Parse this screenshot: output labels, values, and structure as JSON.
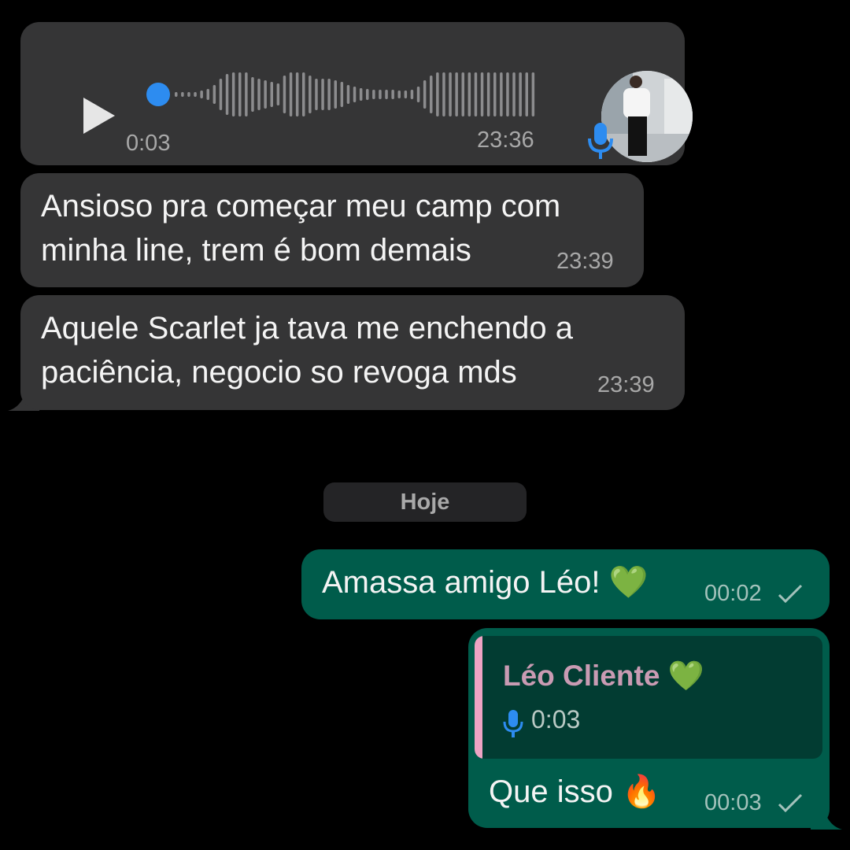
{
  "voice_message": {
    "duration": "0:03",
    "time": "23:36",
    "bar_heights": [
      3,
      3,
      3,
      3,
      5,
      7,
      12,
      20,
      26,
      28,
      28,
      28,
      22,
      20,
      18,
      16,
      14,
      24,
      28,
      28,
      28,
      24,
      20,
      20,
      20,
      18,
      16,
      12,
      10,
      8,
      7,
      6,
      6,
      6,
      6,
      5,
      5,
      6,
      10,
      18,
      24,
      28,
      28,
      28,
      28,
      28,
      28,
      28,
      28,
      28,
      28,
      28,
      28,
      28,
      28,
      28,
      28
    ]
  },
  "messages_in": [
    {
      "text_line1": "Ansioso pra começar meu camp com",
      "text_line2": "minha line, trem é bom demais",
      "time": "23:39"
    },
    {
      "text_line1": "Aquele Scarlet ja tava me enchendo a",
      "text_line2": "paciência, negocio so revoga mds",
      "time": "23:39"
    }
  ],
  "day_divider": "Hoje",
  "messages_out": [
    {
      "text": "Amassa amigo Léo!",
      "emoji": "💚",
      "time": "00:02"
    },
    {
      "quote_name": "Léo Cliente",
      "quote_emoji": "💚",
      "quote_duration": "0:03",
      "text": "Que isso",
      "emoji": "🔥",
      "time": "00:03"
    }
  ],
  "colors": {
    "incoming_bubble": "#353536",
    "outgoing_bubble": "#005c4b",
    "accent_blue": "#2d8cf0",
    "quote_name": "#c99bb3"
  }
}
